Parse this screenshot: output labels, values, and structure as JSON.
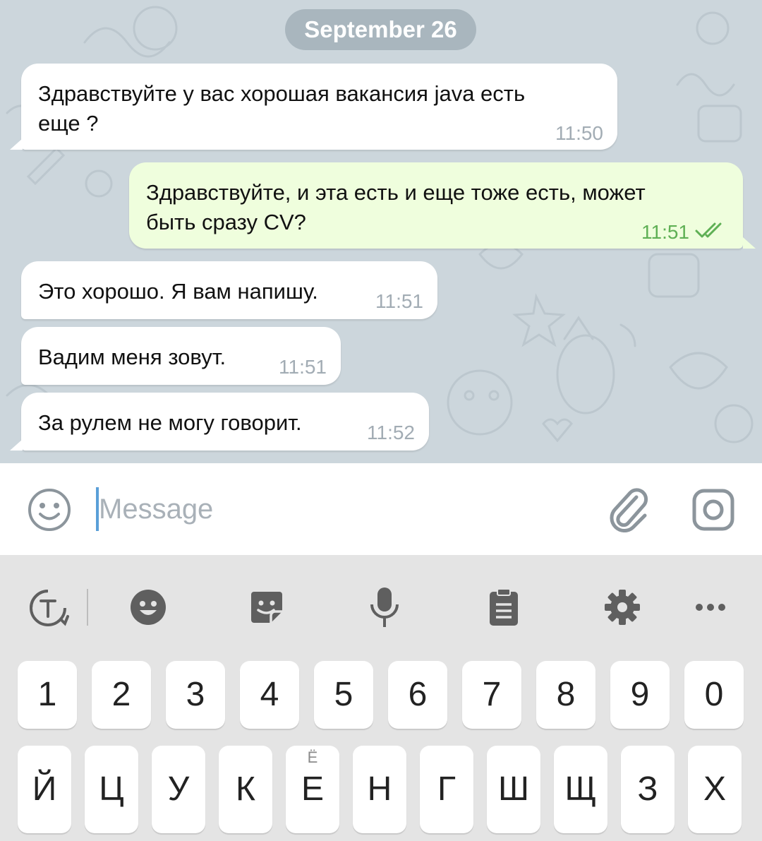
{
  "chat": {
    "date_label": "September 26",
    "messages": [
      {
        "direction": "incoming",
        "lines": [
          "Здравствуйте у вас хорошая вакансия java есть",
          "еще ?"
        ],
        "time": "11:50"
      },
      {
        "direction": "outgoing",
        "lines": [
          "Здравствуйте, и эта есть и еще тоже есть, может",
          "быть сразу CV?"
        ],
        "time": "11:51",
        "status": "read"
      },
      {
        "direction": "incoming",
        "lines": [
          "Это хорошо. Я вам напишу."
        ],
        "time": "11:51"
      },
      {
        "direction": "incoming",
        "lines": [
          "Вадим меня зовут."
        ],
        "time": "11:51"
      },
      {
        "direction": "incoming",
        "lines": [
          "За рулем не могу говорит."
        ],
        "time": "11:52"
      }
    ]
  },
  "input": {
    "placeholder": "Message",
    "emoji_icon": "smiley-icon",
    "attach_icon": "paperclip-icon",
    "camera_icon": "camera-icon"
  },
  "keyboard": {
    "toolbar": [
      "translate-icon",
      "emoji-icon",
      "sticker-icon",
      "microphone-icon",
      "clipboard-icon",
      "settings-icon",
      "more-icon"
    ],
    "number_row": [
      "1",
      "2",
      "3",
      "4",
      "5",
      "6",
      "7",
      "8",
      "9",
      "0"
    ],
    "letter_row": [
      {
        "key": "Й",
        "hint": ""
      },
      {
        "key": "Ц",
        "hint": ""
      },
      {
        "key": "У",
        "hint": ""
      },
      {
        "key": "К",
        "hint": ""
      },
      {
        "key": "Е",
        "hint": "Ё"
      },
      {
        "key": "Н",
        "hint": ""
      },
      {
        "key": "Г",
        "hint": ""
      },
      {
        "key": "Ш",
        "hint": ""
      },
      {
        "key": "Щ",
        "hint": ""
      },
      {
        "key": "З",
        "hint": ""
      },
      {
        "key": "Х",
        "hint": ""
      }
    ]
  },
  "colors": {
    "chat_background": "#ccd6dc",
    "incoming_bubble": "#ffffff",
    "outgoing_bubble": "#effedd",
    "outgoing_time": "#5fb055",
    "accent": "#5a9fd8"
  }
}
